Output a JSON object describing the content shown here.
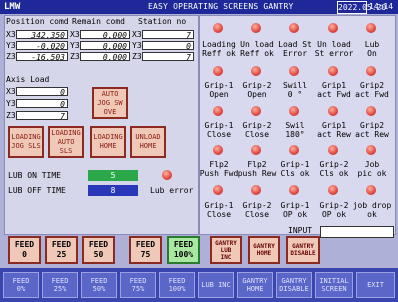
{
  "title": {
    "app": "LMW",
    "screen": "EASY OPERATING SCREENS GANTRY",
    "date": "2022.05.20",
    "time": "14:14"
  },
  "position": {
    "headers": {
      "pos": "Position comd",
      "remain": "Remain comd",
      "station": "Station no"
    },
    "rows": [
      {
        "axis": "X3",
        "pos": "342.350",
        "remain_axis": "X3",
        "remain": "0.000",
        "station_axis": "X3",
        "station": "7"
      },
      {
        "axis": "Y3",
        "pos": "-0.020",
        "remain_axis": "Y3",
        "remain": "0.000",
        "station_axis": "Y3",
        "station": "0"
      },
      {
        "axis": "Z3",
        "pos": "-16.503",
        "remain_axis": "Z3",
        "remain": "0.000",
        "station_axis": "Z3",
        "station": "7"
      }
    ]
  },
  "axis_load": {
    "title": "Axis Load",
    "rows": [
      {
        "axis": "X3",
        "value": "0"
      },
      {
        "axis": "Y3",
        "value": "0"
      },
      {
        "axis": "Z3",
        "value": "7"
      }
    ]
  },
  "auto_jog": {
    "label": "AUTO JOG SW OVE"
  },
  "left_buttons": [
    "LOADING JOG SLS",
    "LOADING AUTO SLS",
    "LOADING HOME",
    "UNLOAD HOME"
  ],
  "lub": {
    "on_label": "LUB ON TIME",
    "on_value": "5",
    "off_label": "LUB OFF TIME",
    "off_value": "8",
    "error_label": "Lub error"
  },
  "status": [
    {
      "label": "Loading\nReff ok"
    },
    {
      "label": "Un load\nReff ok"
    },
    {
      "label": "Load St\nError"
    },
    {
      "label": "Un load\nSt error"
    },
    {
      "label": "Lub\nOn"
    },
    {
      "label": "Grip-1\nOpen"
    },
    {
      "label": "Grip-2\nOpen"
    },
    {
      "label": "Swill\n0 °"
    },
    {
      "label": "Grip1\nact Fwd"
    },
    {
      "label": "Grip2\nact Fwd"
    },
    {
      "label": "Grip-1\nClose"
    },
    {
      "label": "Grip-2\nClose"
    },
    {
      "label": "Swil\n180°"
    },
    {
      "label": "Grip1\nact Rew"
    },
    {
      "label": "Grip2\nact Rew"
    },
    {
      "label": "Flp2\nPush Fwd"
    },
    {
      "label": "Flp2\npush Rew"
    },
    {
      "label": "Grip-1\nCls ok"
    },
    {
      "label": "Grip-2\nCls ok"
    },
    {
      "label": "Job\npic ok"
    },
    {
      "label": "Grip-1\nClose"
    },
    {
      "label": "Grip-2\nClose"
    },
    {
      "label": "Grip-1\nOP ok"
    },
    {
      "label": "Grip-2\nOP ok"
    },
    {
      "label": "job drop\nok"
    }
  ],
  "input_label": "INPUT",
  "feed_buttons": [
    "FEED\n0",
    "FEED\n25",
    "FEED\n50",
    "FEED\n75",
    "FEED\n100%",
    "GANTRY\nLUB\nINC",
    "GANTRY\nHOME",
    "GANTRY\nDISABLE"
  ],
  "function_keys": [
    "FEED\n0%",
    "FEED\n25%",
    "FEED\n50%",
    "FEED\n75%",
    "FEED\n100%",
    "LUB INC",
    "GANTRY\nHOME",
    "GANTRY\nDISABLE",
    "INITIAL\nSCREEN",
    "EXIT"
  ]
}
